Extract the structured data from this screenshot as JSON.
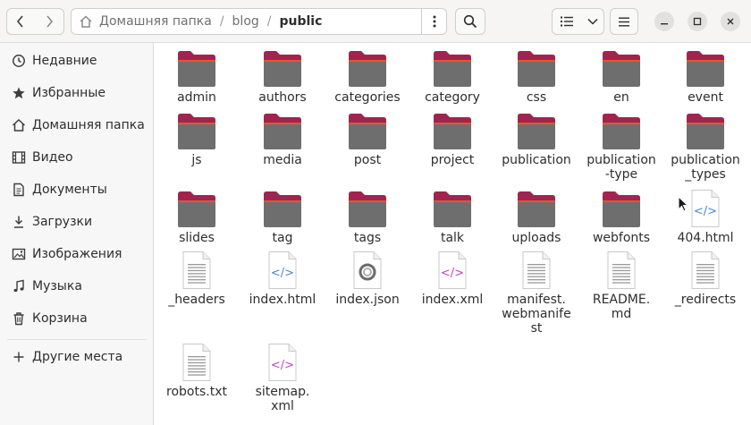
{
  "header": {
    "back_icon": "chevron-left-icon",
    "forward_icon": "chevron-right-icon",
    "path": [
      "Домашняя папка",
      "blog",
      "public"
    ],
    "path_separator": "/",
    "path_menu_icon": "vertical-ellipsis-icon",
    "search_icon": "search-icon",
    "view_icon": "list-view-icon",
    "view_dropdown_icon": "chevron-down-icon",
    "menu_icon": "hamburger-menu-icon",
    "minimize_icon": "minimize-icon",
    "maximize_icon": "maximize-icon",
    "close_icon": "close-icon"
  },
  "sidebar": {
    "items": [
      {
        "label": "Недавние",
        "icon": "clock-icon"
      },
      {
        "label": "Избранные",
        "icon": "star-icon"
      },
      {
        "label": "Домашняя папка",
        "icon": "home-icon"
      },
      {
        "label": "Видео",
        "icon": "film-icon"
      },
      {
        "label": "Документы",
        "icon": "document-icon"
      },
      {
        "label": "Загрузки",
        "icon": "download-icon"
      },
      {
        "label": "Изображения",
        "icon": "image-icon"
      },
      {
        "label": "Музыка",
        "icon": "music-icon"
      },
      {
        "label": "Корзина",
        "icon": "trash-icon"
      },
      {
        "label": "Другие места",
        "icon": "plus-icon"
      }
    ]
  },
  "files": [
    {
      "name": "admin",
      "kind": "folder"
    },
    {
      "name": "authors",
      "kind": "folder"
    },
    {
      "name": "categories",
      "kind": "folder"
    },
    {
      "name": "category",
      "kind": "folder"
    },
    {
      "name": "css",
      "kind": "folder"
    },
    {
      "name": "en",
      "kind": "folder"
    },
    {
      "name": "event",
      "kind": "folder"
    },
    {
      "name": "js",
      "kind": "folder"
    },
    {
      "name": "media",
      "kind": "folder"
    },
    {
      "name": "post",
      "kind": "folder"
    },
    {
      "name": "project",
      "kind": "folder"
    },
    {
      "name": "publication",
      "kind": "folder"
    },
    {
      "name": "publication\n-type",
      "kind": "folder"
    },
    {
      "name": "publication\n_types",
      "kind": "folder"
    },
    {
      "name": "slides",
      "kind": "folder"
    },
    {
      "name": "tag",
      "kind": "folder"
    },
    {
      "name": "tags",
      "kind": "folder"
    },
    {
      "name": "talk",
      "kind": "folder"
    },
    {
      "name": "uploads",
      "kind": "folder"
    },
    {
      "name": "webfonts",
      "kind": "folder"
    },
    {
      "name": "404.html",
      "kind": "html"
    },
    {
      "name": "_headers",
      "kind": "text"
    },
    {
      "name": "index.html",
      "kind": "html"
    },
    {
      "name": "index.json",
      "kind": "json"
    },
    {
      "name": "index.xml",
      "kind": "xml"
    },
    {
      "name": "manifest.\nwebmanife\nst",
      "kind": "text"
    },
    {
      "name": "README.\nmd",
      "kind": "text"
    },
    {
      "name": "_redirects",
      "kind": "text"
    },
    {
      "name": "robots.txt",
      "kind": "text"
    },
    {
      "name": "sitemap.\nxml",
      "kind": "xml"
    }
  ],
  "colors": {
    "folder_body": "#6e6e6e",
    "folder_tab": "#a0244f",
    "folder_edge": "#e3572c",
    "html_code": "#4a86d8",
    "xml_code": "#c243c9",
    "json_ring": "#6b6b6b"
  }
}
